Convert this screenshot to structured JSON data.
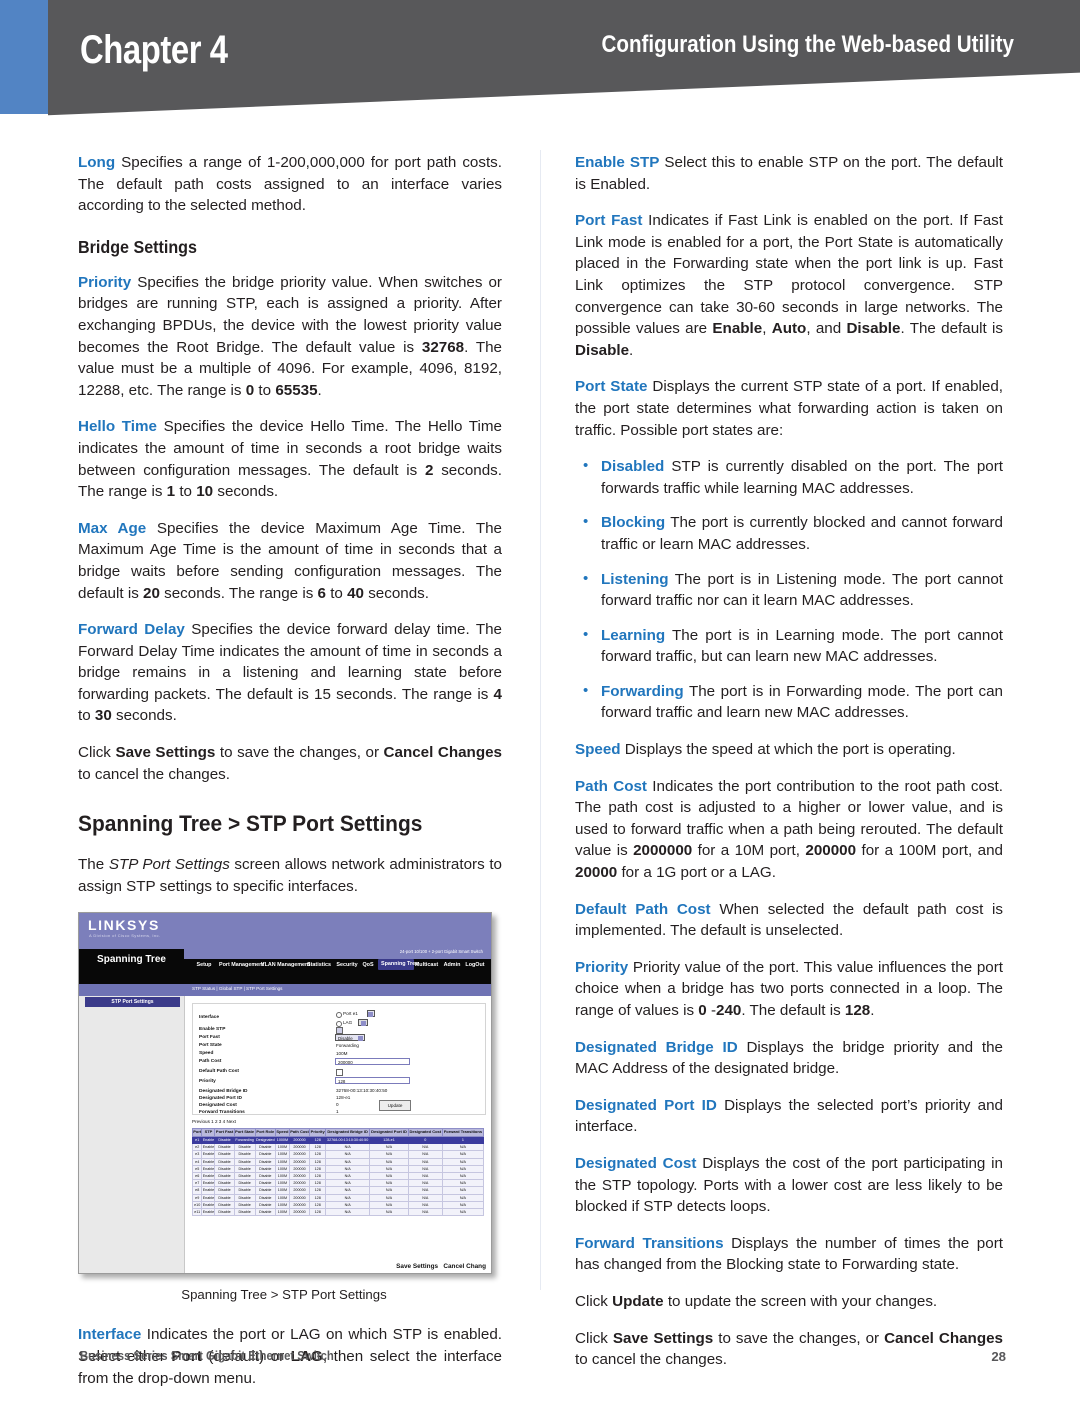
{
  "header": {
    "chapter": "Chapter 4",
    "subtitle": "Configuration Using the Web-based Utility"
  },
  "left_column": {
    "para_long": {
      "term": "Long",
      "text": " Specifies a range of 1-200,000,000 for port path costs. The default path costs assigned to an interface varies according to the selected method."
    },
    "subhead_bridge_settings": "Bridge Settings",
    "para_priority": {
      "term": "Priority",
      "t1": " Specifies the bridge priority value. When switches or bridges are running STP, each is assigned a priority. After exchanging BPDUs, the device with the lowest priority value becomes the Root Bridge. The default value is ",
      "b1": "32768",
      "t2": ". The value must be a multiple of 4096. For example, 4096, 8192, 12288, etc. The range is ",
      "b2": "0",
      "t3": " to ",
      "b3": "65535",
      "t4": "."
    },
    "para_hello_time": {
      "term": "Hello Time",
      "t1": " Specifies the device Hello Time. The Hello Time indicates the amount of time in seconds a root bridge waits between configuration messages. The default is ",
      "b1": "2",
      "t2": " seconds. The range is ",
      "b2": "1",
      "t3": " to ",
      "b3": "10",
      "t4": " seconds."
    },
    "para_max_age": {
      "term": "Max Age",
      "t1": " Specifies the device Maximum Age Time. The Maximum Age Time is the amount of time in seconds that a bridge waits before sending configuration messages. The default is ",
      "b1": "20",
      "t2": " seconds. The range is ",
      "b2": "6",
      "t3": " to ",
      "b3": "40",
      "t4": " seconds."
    },
    "para_forward_delay": {
      "term": "Forward Delay",
      "t1": " Specifies the device forward delay time. The Forward Delay Time indicates the amount of time in seconds a bridge remains in a listening and learning state before forwarding packets. The default is 15 seconds. The range is ",
      "b1": "4",
      "t2": " to ",
      "b2": "30",
      "t3": " seconds."
    },
    "para_save": {
      "t1": "Click ",
      "b1": "Save Settings",
      "t2": " to save the changes, or ",
      "b2": "Cancel Changes",
      "t3": " to cancel the changes."
    },
    "sechead_stp_port_settings": "Spanning Tree > STP Port Settings",
    "para_intro": {
      "t1": "The ",
      "it1": "STP Port Settings",
      "t2": " screen allows network administrators to assign STP settings to specific interfaces."
    },
    "figure_caption": "Spanning Tree > STP Port Settings",
    "para_interface": {
      "term": "Interface",
      "t1": " Indicates the port or LAG on which STP is enabled. Select either ",
      "b1": "Port",
      "t2": " (default) or ",
      "b2": "LAG",
      "t3": ", then select the interface from the drop-down menu."
    }
  },
  "right_column": {
    "para_enable_stp": {
      "term": "Enable STP",
      "text": " Select this to enable STP on the port. The default is Enabled."
    },
    "para_port_fast": {
      "term": "Port Fast",
      "t1": " Indicates if Fast Link is enabled on the port. If Fast Link mode is enabled for a port, the Port State is automatically placed in the Forwarding state when the port link is up. Fast Link optimizes the STP protocol convergence. STP convergence can take 30-60 seconds in large networks. The possible values are ",
      "b1": "Enable",
      "t2": ", ",
      "b2": "Auto",
      "t3": ", and ",
      "b3": "Disable",
      "t4": ". The default is ",
      "b4": "Disable",
      "t5": "."
    },
    "para_port_state": {
      "term": "Port State",
      "text": " Displays the current STP state of a port. If enabled, the port state determines what forwarding action is taken on traffic. Possible port states are:"
    },
    "port_states": [
      {
        "term": "Disabled",
        "text": " STP is currently disabled on the port. The port forwards traffic while learning MAC addresses."
      },
      {
        "term": "Blocking",
        "text": " The port is currently blocked and cannot forward traffic or learn MAC addresses."
      },
      {
        "term": "Listening",
        "text": " The port is in Listening mode. The port cannot forward traffic nor can it learn MAC addresses."
      },
      {
        "term": "Learning",
        "text": " The port is in Learning mode. The port cannot forward traffic, but can learn new MAC addresses."
      },
      {
        "term": "Forwarding",
        "text": "  The port is in Forwarding mode. The port can forward traffic and learn new MAC addresses."
      }
    ],
    "para_speed": {
      "term": "Speed",
      "text": "  Displays the speed at which the port is operating."
    },
    "para_path_cost": {
      "term": "Path Cost",
      "t1": "  Indicates the port contribution to the root path cost. The path cost is adjusted to a higher or lower value, and is used to forward traffic when a path being rerouted. The default value is ",
      "b1": "2000000",
      "t2": " for a 10M port, ",
      "b2": "200000",
      "t3": " for a 100M port, and ",
      "b3": "20000",
      "t4": " for a 1G port or a LAG."
    },
    "para_default_path_cost": {
      "term": "Default Path Cost",
      "text": "  When selected the default path cost is implemented. The default is unselected."
    },
    "para_priority": {
      "term": "Priority",
      "t1": "  Priority value of the port. This value influences the port choice when a bridge has two ports connected in a loop. The range of values is ",
      "b1": "0",
      "t2": " -",
      "b2": "240",
      "t3": ". The default is ",
      "b3": "128",
      "t4": "."
    },
    "para_designated_bridge_id": {
      "term": "Designated Bridge ID",
      "text": "  Displays the bridge priority and the MAC Address of the designated bridge."
    },
    "para_designated_port_id": {
      "term": "Designated Port ID",
      "text": "  Displays the selected port’s priority and interface."
    },
    "para_designated_cost": {
      "term": "Designated Cost",
      "text": " Displays the cost of the port participating in the STP topology. Ports with a lower cost are less likely to be blocked if STP detects loops."
    },
    "para_forward_transitions": {
      "term": "Forward Transitions",
      "text": "  Displays the number of times the port has changed from the Blocking state to Forwarding state."
    },
    "para_update": {
      "t1": "Click ",
      "b1": "Update",
      "t2": " to update the screen with your changes."
    },
    "para_save": {
      "t1": "Click ",
      "b1": "Save Settings",
      "t2": " to save the changes, or ",
      "b2": "Cancel Changes",
      "t3": " to cancel the changes."
    }
  },
  "screenshot": {
    "brand": "LINKSYS",
    "brand_sub": "A Division of Cisco Systems, Inc.",
    "page_title": "Spanning Tree",
    "model": "24-port 10/100 + 2-port Gigabit Smart Switch",
    "tabs": [
      "Setup",
      "Port Management",
      "VLAN Management",
      "Statistics",
      "Security",
      "QoS",
      "Spanning Tree",
      "Multicast",
      "Admin",
      "LogOut"
    ],
    "active_tab": "Spanning Tree",
    "breadcrumb": "STP Status  |  Global STP  |  STP Port Settings",
    "panel_title": "STP Port Settings",
    "form": [
      {
        "label": "Interface",
        "value": ""
      },
      {
        "label": "Enable STP",
        "value": ""
      },
      {
        "label": "Port Fast",
        "value": "Disable"
      },
      {
        "label": "Port State",
        "value": "Forwarding"
      },
      {
        "label": "Speed",
        "value": "100M"
      },
      {
        "label": "Path Cost",
        "value": "200000"
      },
      {
        "label": "Default Path Cost",
        "value": ""
      },
      {
        "label": "Priority",
        "value": "128"
      },
      {
        "label": "Designated Bridge ID",
        "value": "32768-00:13:10:30:40:50"
      },
      {
        "label": "Designated Port ID",
        "value": "128-e1"
      },
      {
        "label": "Designated Cost",
        "value": "0"
      },
      {
        "label": "Forward Transitions",
        "value": "1"
      }
    ],
    "radio_port": "Port e1",
    "radio_lag": "LAG",
    "update_button": "Update",
    "pager": "Previous   1   2   3   4   Next",
    "table_headers": [
      "Port",
      "STP",
      "Port Fast",
      "Port State",
      "Port Role",
      "Speed",
      "Path Cost",
      "Priority",
      "Designated Bridge ID",
      "Designated Port ID",
      "Designated Cost",
      "Forward Transitions"
    ],
    "table_rows": [
      [
        "e1",
        "Enable",
        "Disable",
        "Forwarding",
        "Designated",
        "1000M",
        "200000",
        "128",
        "32768-00:13:10:30:40:50",
        "128-e1",
        "0",
        "1"
      ],
      [
        "e2",
        "Enable",
        "Disable",
        "Disable",
        "Disable",
        "100M",
        "200000",
        "128",
        "N/A",
        "N/A",
        "N/A",
        "N/A"
      ],
      [
        "e3",
        "Enable",
        "Disable",
        "Disable",
        "Disable",
        "100M",
        "200000",
        "128",
        "N/A",
        "N/A",
        "N/A",
        "N/A"
      ],
      [
        "e4",
        "Enable",
        "Disable",
        "Disable",
        "Disable",
        "100M",
        "200000",
        "128",
        "N/A",
        "N/A",
        "N/A",
        "N/A"
      ],
      [
        "e5",
        "Enable",
        "Disable",
        "Disable",
        "Disable",
        "100M",
        "200000",
        "128",
        "N/A",
        "N/A",
        "N/A",
        "N/A"
      ],
      [
        "e6",
        "Enable",
        "Disable",
        "Disable",
        "Disable",
        "100M",
        "200000",
        "128",
        "N/A",
        "N/A",
        "N/A",
        "N/A"
      ],
      [
        "e7",
        "Enable",
        "Disable",
        "Disable",
        "Disable",
        "100M",
        "200000",
        "128",
        "N/A",
        "N/A",
        "N/A",
        "N/A"
      ],
      [
        "e8",
        "Enable",
        "Disable",
        "Disable",
        "Disable",
        "100M",
        "200000",
        "128",
        "N/A",
        "N/A",
        "N/A",
        "N/A"
      ],
      [
        "e9",
        "Enable",
        "Disable",
        "Disable",
        "Disable",
        "100M",
        "200000",
        "128",
        "N/A",
        "N/A",
        "N/A",
        "N/A"
      ],
      [
        "e10",
        "Enable",
        "Disable",
        "Disable",
        "Disable",
        "100M",
        "200000",
        "128",
        "N/A",
        "N/A",
        "N/A",
        "N/A"
      ],
      [
        "e11",
        "Enable",
        "Disable",
        "Disable",
        "Disable",
        "100M",
        "200000",
        "128",
        "N/A",
        "N/A",
        "N/A",
        "N/A"
      ]
    ],
    "save_settings": "Save Settings",
    "cancel_changes": "Cancel Chang"
  },
  "footer": {
    "left": "Business Series Smart Gigabit Ethernet Switch",
    "page_number": "28"
  }
}
